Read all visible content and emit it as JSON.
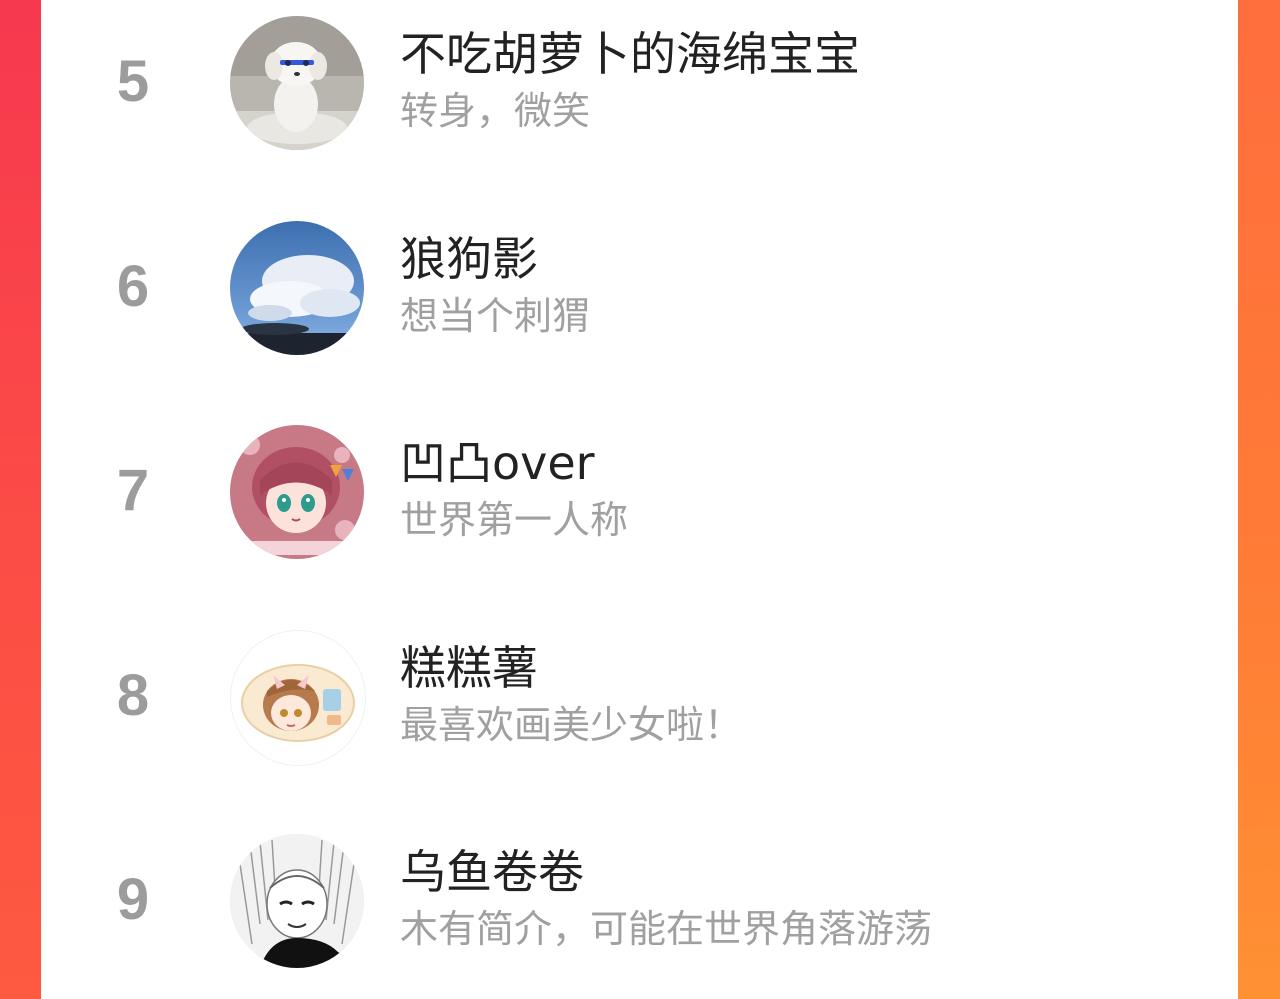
{
  "ranking": {
    "items": [
      {
        "rank": "5",
        "name": "不吃胡萝卜的海绵宝宝",
        "bio": "转身，微笑",
        "avatar_icon": "white-dog-avatar-icon"
      },
      {
        "rank": "6",
        "name": "狼狗影",
        "bio": "想当个刺猬",
        "avatar_icon": "sky-clouds-avatar-icon"
      },
      {
        "rank": "7",
        "name": "凹凸over",
        "bio": "世界第一人称",
        "avatar_icon": "anime-girl-pink-avatar-icon"
      },
      {
        "rank": "8",
        "name": "糕糕薯",
        "bio": "最喜欢画美少女啦！",
        "avatar_icon": "anime-girl-sticker-avatar-icon"
      },
      {
        "rank": "9",
        "name": "乌鱼卷卷",
        "bio": "木有简介，可能在世界角落游荡",
        "avatar_icon": "manga-girl-bw-avatar-icon"
      }
    ]
  },
  "colors": {
    "background_left": "#f7384f",
    "background_right": "#ff7b36",
    "card": "#ffffff",
    "rank_number": "#9c9c9c",
    "name_text": "#222222",
    "bio_text": "#a0a0a0"
  }
}
